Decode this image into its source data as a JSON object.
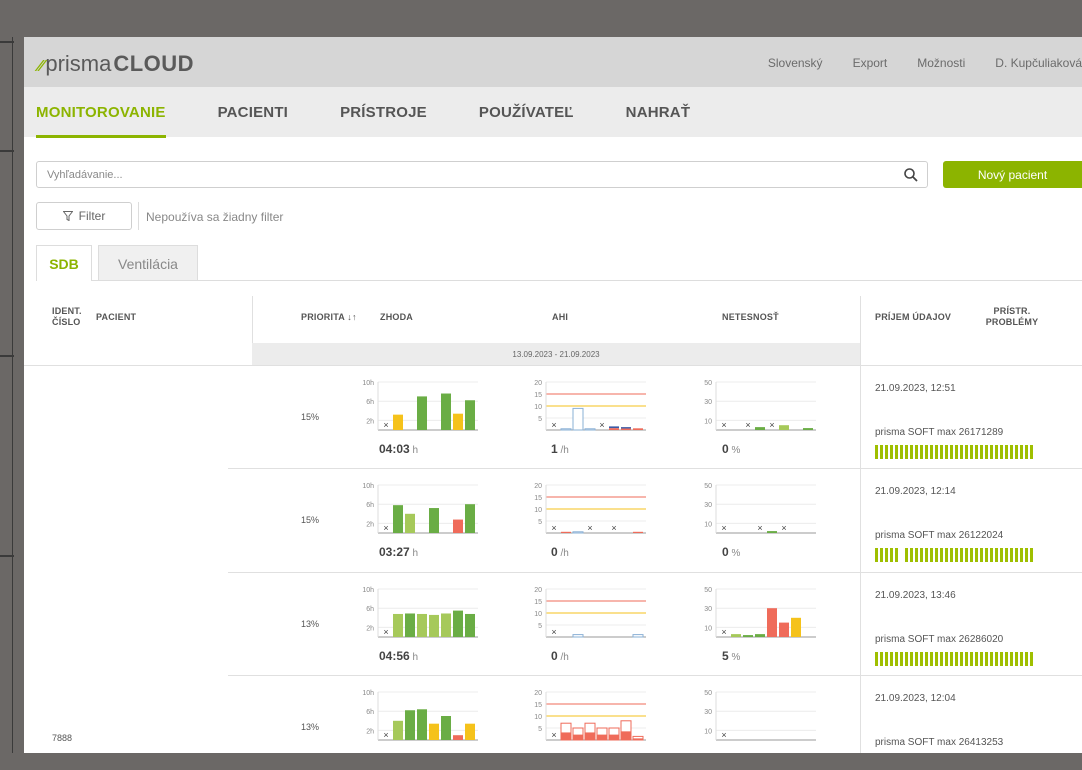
{
  "brand": {
    "mark": "⁄⁄",
    "name_light": "prisma",
    "name_bold": "CLOUD"
  },
  "topnav": [
    "Slovenský",
    "Export",
    "Možnosti",
    "D. Kupčuliaková"
  ],
  "nav": {
    "items": [
      "MONITOROVANIE",
      "PACIENTI",
      "PRÍSTROJE",
      "POUŽÍVATEĽ",
      "NAHRAŤ"
    ],
    "active": "MONITOROVANIE"
  },
  "search": {
    "placeholder": "Vyhľadávanie..."
  },
  "new_patient_label": "Nový pacient",
  "filter": {
    "label": "Filter",
    "status": "Nepoužíva sa žiadny filter"
  },
  "tabs": [
    "SDB",
    "Ventilácia"
  ],
  "columns": {
    "ident": "IDENT. ČÍSLO",
    "patient": "PACIENT",
    "priority": "PRIORITA ↓↑",
    "compliance": "ZHODA",
    "ahi": "AHI",
    "leak": "NETESNOSŤ",
    "received": "PRÍJEM ÚDAJOV",
    "device_problems": "PRÍSTR. PROBLÉMY"
  },
  "date_range": "13.09.2023 - 21.09.2023",
  "patient_id": "7888",
  "axes": {
    "compliance": [
      "10h",
      "6h",
      "2h"
    ],
    "ahi": [
      "20",
      "15",
      "10",
      "5"
    ],
    "leak": [
      "50",
      "30",
      "10"
    ]
  },
  "colors": {
    "accent": "#8cb400",
    "green": "#6aad45",
    "light_green": "#a6c95a",
    "yellow": "#f5c21b",
    "red": "#ef6b5a",
    "blue": "#3b5ba5"
  },
  "rows": [
    {
      "priority": "15%",
      "compliance_value": "04:03",
      "compliance_unit": " h",
      "ahi_value": "1",
      "ahi_unit": " /h",
      "leak_value": "0",
      "leak_unit": " %",
      "received": "21.09.2023, 12:51",
      "device": "prisma SOFT max  26171289",
      "compliance_bars": [
        {
          "v": 0,
          "c": "x"
        },
        {
          "v": 3.2,
          "c": "yellow"
        },
        {
          "v": 0,
          "c": "none"
        },
        {
          "v": 7,
          "c": "green"
        },
        {
          "v": 0,
          "c": "none"
        },
        {
          "v": 7.6,
          "c": "green"
        },
        {
          "v": 3.4,
          "c": "yellow"
        },
        {
          "v": 6.2,
          "c": "green"
        }
      ],
      "ahi_bars": [
        {
          "v": 0,
          "c": "x"
        },
        {
          "v": 0.5,
          "c": "outline"
        },
        {
          "v": 9,
          "c": "outline"
        },
        {
          "v": 0.5,
          "c": "outline"
        },
        {
          "v": 0,
          "c": "x"
        },
        {
          "v": 1.5,
          "c": "mixed"
        },
        {
          "v": 1.2,
          "c": "mixed"
        },
        {
          "v": 0.7,
          "c": "red"
        }
      ],
      "leak_bars": [
        {
          "v": 0,
          "c": "x"
        },
        {
          "v": 0,
          "c": "none"
        },
        {
          "v": 0,
          "c": "x"
        },
        {
          "v": 3,
          "c": "green"
        },
        {
          "v": 0,
          "c": "x"
        },
        {
          "v": 5,
          "c": "light_green"
        },
        {
          "v": 0,
          "c": "none"
        },
        {
          "v": 2,
          "c": "green"
        }
      ]
    },
    {
      "priority": "15%",
      "compliance_value": "03:27",
      "compliance_unit": " h",
      "ahi_value": "0",
      "ahi_unit": " /h",
      "leak_value": "0",
      "leak_unit": " %",
      "received": "21.09.2023, 12:14",
      "device": "prisma SOFT max  26122024",
      "compliance_bars": [
        {
          "v": 0,
          "c": "x"
        },
        {
          "v": 5.8,
          "c": "green"
        },
        {
          "v": 4,
          "c": "light_green"
        },
        {
          "v": 0,
          "c": "none"
        },
        {
          "v": 5.2,
          "c": "green"
        },
        {
          "v": 0,
          "c": "none"
        },
        {
          "v": 2.8,
          "c": "red"
        },
        {
          "v": 6,
          "c": "green"
        }
      ],
      "ahi_bars": [
        {
          "v": 0,
          "c": "x"
        },
        {
          "v": 0.5,
          "c": "red"
        },
        {
          "v": 0.5,
          "c": "outline"
        },
        {
          "v": 0,
          "c": "x"
        },
        {
          "v": 0,
          "c": "none"
        },
        {
          "v": 0,
          "c": "x"
        },
        {
          "v": 0,
          "c": "none"
        },
        {
          "v": 0.5,
          "c": "red"
        }
      ],
      "leak_bars": [
        {
          "v": 0,
          "c": "x"
        },
        {
          "v": 0,
          "c": "none"
        },
        {
          "v": 0,
          "c": "none"
        },
        {
          "v": 0,
          "c": "x"
        },
        {
          "v": 2,
          "c": "green"
        },
        {
          "v": 0,
          "c": "x"
        },
        {
          "v": 0,
          "c": "none"
        },
        {
          "v": 0,
          "c": "none"
        }
      ]
    },
    {
      "priority": "13%",
      "compliance_value": "04:56",
      "compliance_unit": " h",
      "ahi_value": "0",
      "ahi_unit": " /h",
      "leak_value": "5",
      "leak_unit": " %",
      "received": "21.09.2023, 13:46",
      "device": "prisma SOFT max  26286020",
      "compliance_bars": [
        {
          "v": 0,
          "c": "x"
        },
        {
          "v": 4.8,
          "c": "light_green"
        },
        {
          "v": 4.9,
          "c": "green"
        },
        {
          "v": 4.8,
          "c": "light_green"
        },
        {
          "v": 4.6,
          "c": "light_green"
        },
        {
          "v": 4.9,
          "c": "light_green"
        },
        {
          "v": 5.5,
          "c": "green"
        },
        {
          "v": 4.8,
          "c": "green"
        }
      ],
      "ahi_bars": [
        {
          "v": 0,
          "c": "x"
        },
        {
          "v": 0,
          "c": "none"
        },
        {
          "v": 1,
          "c": "outline"
        },
        {
          "v": 0,
          "c": "none"
        },
        {
          "v": 0,
          "c": "none"
        },
        {
          "v": 0,
          "c": "none"
        },
        {
          "v": 0,
          "c": "none"
        },
        {
          "v": 1,
          "c": "outline"
        }
      ],
      "leak_bars": [
        {
          "v": 0,
          "c": "x"
        },
        {
          "v": 3,
          "c": "light_green"
        },
        {
          "v": 2,
          "c": "green"
        },
        {
          "v": 3,
          "c": "green"
        },
        {
          "v": 30,
          "c": "red"
        },
        {
          "v": 15,
          "c": "red"
        },
        {
          "v": 20,
          "c": "yellow"
        },
        {
          "v": 0,
          "c": "none"
        }
      ]
    },
    {
      "priority": "13%",
      "compliance_value": "",
      "compliance_unit": "",
      "ahi_value": "",
      "ahi_unit": "",
      "leak_value": "",
      "leak_unit": "",
      "received": "21.09.2023, 12:04",
      "device": "prisma SOFT max  26413253",
      "compliance_bars": [
        {
          "v": 0,
          "c": "x"
        },
        {
          "v": 4,
          "c": "light_green"
        },
        {
          "v": 6.2,
          "c": "green"
        },
        {
          "v": 6.4,
          "c": "green"
        },
        {
          "v": 3.4,
          "c": "yellow"
        },
        {
          "v": 5,
          "c": "green"
        },
        {
          "v": 1,
          "c": "red"
        },
        {
          "v": 3.4,
          "c": "yellow"
        }
      ],
      "ahi_bars": [
        {
          "v": 0,
          "c": "x"
        },
        {
          "v": 7,
          "c": "mixed_out"
        },
        {
          "v": 5,
          "c": "mixed_out"
        },
        {
          "v": 7,
          "c": "mixed_out"
        },
        {
          "v": 5,
          "c": "mixed_out"
        },
        {
          "v": 5,
          "c": "mixed_out"
        },
        {
          "v": 8,
          "c": "mixed_out"
        },
        {
          "v": 1.5,
          "c": "mixed_out"
        }
      ],
      "leak_bars": [
        {
          "v": 0,
          "c": "x"
        },
        {
          "v": 0,
          "c": "none"
        },
        {
          "v": 0,
          "c": "none"
        },
        {
          "v": 0,
          "c": "none"
        },
        {
          "v": 0,
          "c": "none"
        },
        {
          "v": 0,
          "c": "none"
        },
        {
          "v": 0,
          "c": "none"
        },
        {
          "v": 0,
          "c": "none"
        }
      ]
    }
  ]
}
